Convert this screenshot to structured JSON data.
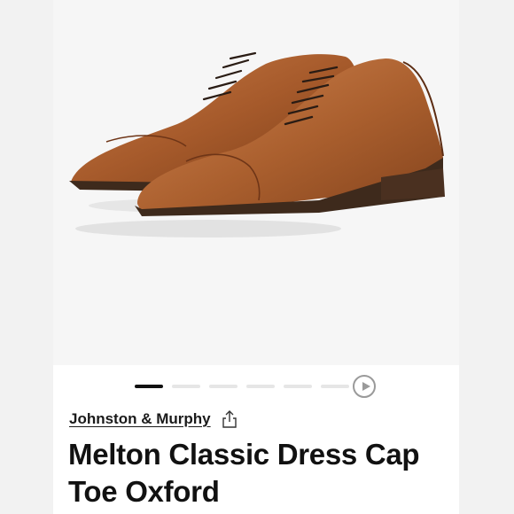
{
  "product": {
    "brand": "Johnston & Murphy",
    "name": "Melton Classic Dress Cap Toe Oxford",
    "image_icon": "product-photo-oxford-shoes"
  },
  "gallery": {
    "total_images": 6,
    "active_index": 0,
    "has_video": true
  },
  "icons": {
    "share": "share-icon",
    "play": "play-video-icon"
  },
  "colors": {
    "leather": "#a0582a",
    "sole": "#3e2a1c",
    "active_dot": "#111111"
  }
}
